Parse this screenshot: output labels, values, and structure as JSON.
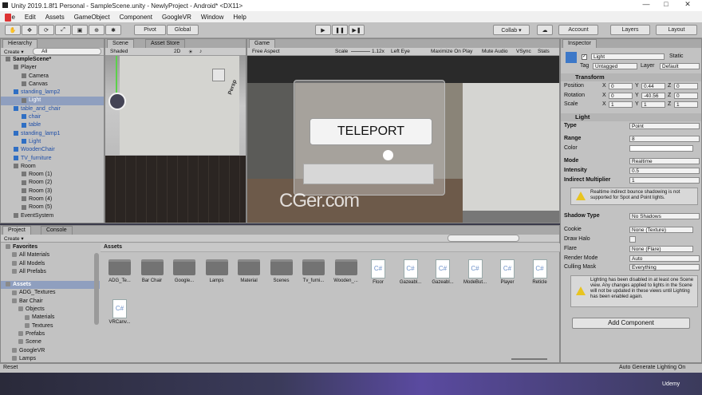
{
  "window": {
    "title": "Unity 2019.1.8f1 Personal - SampleScene.unity - NewlyProject - Android* <DX11>",
    "min": "—",
    "max": "□",
    "close": "✕"
  },
  "menu": [
    "File",
    "Edit",
    "Assets",
    "GameObject",
    "Component",
    "GoogleVR",
    "Window",
    "Help"
  ],
  "toolbar": {
    "pivot": "Pivot",
    "global": "Global",
    "collab": "Collab ▾",
    "account": "Account",
    "layers": "Layers",
    "layout": "Layout"
  },
  "hierarchy": {
    "tab": "Hierarchy",
    "create": "Create ▾",
    "search": "All",
    "items": [
      {
        "label": "SampleScene*",
        "indent": 0,
        "bold": true
      },
      {
        "label": "Player",
        "indent": 1
      },
      {
        "label": "Camera",
        "indent": 2
      },
      {
        "label": "Canvas",
        "indent": 2
      },
      {
        "label": "standing_lamp2",
        "indent": 1,
        "blue": true
      },
      {
        "label": "Light",
        "indent": 2,
        "selected": true
      },
      {
        "label": "table_and_chair",
        "indent": 1,
        "blue": true
      },
      {
        "label": "chair",
        "indent": 2,
        "blue": true
      },
      {
        "label": "table",
        "indent": 2,
        "blue": true
      },
      {
        "label": "standing_lamp1",
        "indent": 1,
        "blue": true
      },
      {
        "label": "Light",
        "indent": 2,
        "blue": true
      },
      {
        "label": "WoodenChair",
        "indent": 1,
        "blue": true
      },
      {
        "label": "TV_furniture",
        "indent": 1,
        "blue": true
      },
      {
        "label": "Room",
        "indent": 1
      },
      {
        "label": "Room (1)",
        "indent": 2
      },
      {
        "label": "Room (2)",
        "indent": 2
      },
      {
        "label": "Room (3)",
        "indent": 2
      },
      {
        "label": "Room (4)",
        "indent": 2
      },
      {
        "label": "Room (5)",
        "indent": 2
      },
      {
        "label": "EventSystem",
        "indent": 1
      }
    ]
  },
  "scene": {
    "tab_scene": "Scene",
    "tab_store": "Asset Store",
    "shading": "Shaded",
    "mode": "2D",
    "gizmo_label": "Persp"
  },
  "game": {
    "tab": "Game",
    "aspect": "Free Aspect",
    "scale_label": "Scale",
    "scale_value": "1.12x",
    "eye": "Left Eye",
    "max_on_play": "Maximize On Play",
    "mute": "Mute Audio",
    "vsync": "VSync",
    "stats": "Stats",
    "teleport": "TELEPORT",
    "watermark": "CGer.com"
  },
  "project": {
    "tab_project": "Project",
    "tab_console": "Console",
    "create": "Create ▾",
    "favorites": "Favorites",
    "fav_items": [
      "All Materials",
      "All Models",
      "All Prefabs"
    ],
    "assets_root": "Assets",
    "tree": [
      {
        "label": "ADG_Textures",
        "indent": 1
      },
      {
        "label": "Bar Chair",
        "indent": 1
      },
      {
        "label": "Objects",
        "indent": 2
      },
      {
        "label": "Materials",
        "indent": 3
      },
      {
        "label": "Textures",
        "indent": 3
      },
      {
        "label": "Prefabs",
        "indent": 2
      },
      {
        "label": "Scene",
        "indent": 2
      },
      {
        "label": "GoogleVR",
        "indent": 1
      },
      {
        "label": "Lamps",
        "indent": 1
      }
    ],
    "breadcrumb": "Assets",
    "folders": [
      "ADG_Te...",
      "Bar Chair",
      "Google...",
      "Lamps",
      "Material",
      "Scenes",
      "Tv_furni...",
      "Wooden_..."
    ],
    "scripts": [
      "Floor",
      "Gazeabl...",
      "Gazeabl...",
      "ModeBut...",
      "Player",
      "Reticle",
      "VRCanv..."
    ]
  },
  "inspector": {
    "tab": "Inspector",
    "name": "Light",
    "static": "Static",
    "tag_label": "Tag",
    "tag": "Untagged",
    "layer_label": "Layer",
    "layer": "Default",
    "transform": {
      "title": "Transform",
      "position": "Position",
      "rotation": "Rotation",
      "scale": "Scale",
      "pos": [
        "0",
        "0.44",
        "0"
      ],
      "rot": [
        "0",
        "-40.56",
        "0"
      ],
      "scl": [
        "1",
        "1",
        "1"
      ]
    },
    "light": {
      "title": "Light",
      "type_label": "Type",
      "type": "Point",
      "range_label": "Range",
      "range": "8",
      "color_label": "Color",
      "mode_label": "Mode",
      "mode": "Realtime",
      "intensity_label": "Intensity",
      "intensity": "0.5",
      "indirect_label": "Indirect Multiplier",
      "indirect": "1",
      "help1": "Realtime indirect bounce shadowing is not supported for Spot and Point lights.",
      "shadow_label": "Shadow Type",
      "shadow": "No Shadows",
      "cookie_label": "Cookie",
      "cookie": "None (Texture)",
      "halo_label": "Draw Halo",
      "flare_label": "Flare",
      "flare": "None (Flare)",
      "render_label": "Render Mode",
      "render": "Auto",
      "culling_label": "Culling Mask",
      "culling": "Everything",
      "help2": "Lighting has been disabled in at least one Scene view. Any changes applied to lights in the Scene will not be updated in these views until Lighting has been enabled again."
    },
    "add_component": "Add Component"
  },
  "status": {
    "left": "Reset",
    "right": "Auto Generate Lighting On"
  },
  "udemy": "Udemy"
}
